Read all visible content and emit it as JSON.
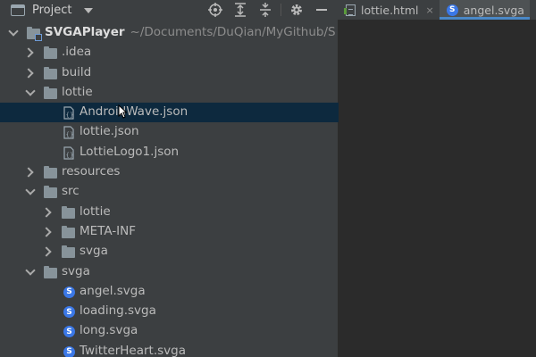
{
  "panel": {
    "title": "Project"
  },
  "tabs": [
    {
      "label": "lottie.html",
      "close": "×",
      "active": false
    },
    {
      "label": "angel.svga",
      "close": "",
      "active": true
    }
  ],
  "tree": {
    "root": {
      "label": "SVGAPlayer",
      "path": "~/Documents/DuQian/MyGithub/S"
    },
    "items": [
      {
        "label": ".idea"
      },
      {
        "label": "build"
      },
      {
        "label": "lottie"
      },
      {
        "label": "AndroidWave.json"
      },
      {
        "label": "lottie.json"
      },
      {
        "label": "LottieLogo1.json"
      },
      {
        "label": "resources"
      },
      {
        "label": "src"
      },
      {
        "label": "lottie"
      },
      {
        "label": "META-INF"
      },
      {
        "label": "svga"
      },
      {
        "label": "svga"
      },
      {
        "label": "angel.svga"
      },
      {
        "label": "loading.svga"
      },
      {
        "label": "long.svga"
      },
      {
        "label": "TwitterHeart.svga"
      }
    ],
    "svga_badge": "S"
  },
  "colors": {
    "panel_bg": "#3c3f41",
    "editor_bg": "#2b2b2b",
    "selection": "#0d293e",
    "accent": "#4a88c7",
    "svga_icon": "#3b78e7"
  },
  "icons": [
    "window-icon",
    "target-icon",
    "expand-all-icon",
    "collapse-all-icon",
    "gear-icon",
    "minimize-icon",
    "folder-icon",
    "json-file-icon",
    "svga-file-icon",
    "html-file-icon"
  ]
}
